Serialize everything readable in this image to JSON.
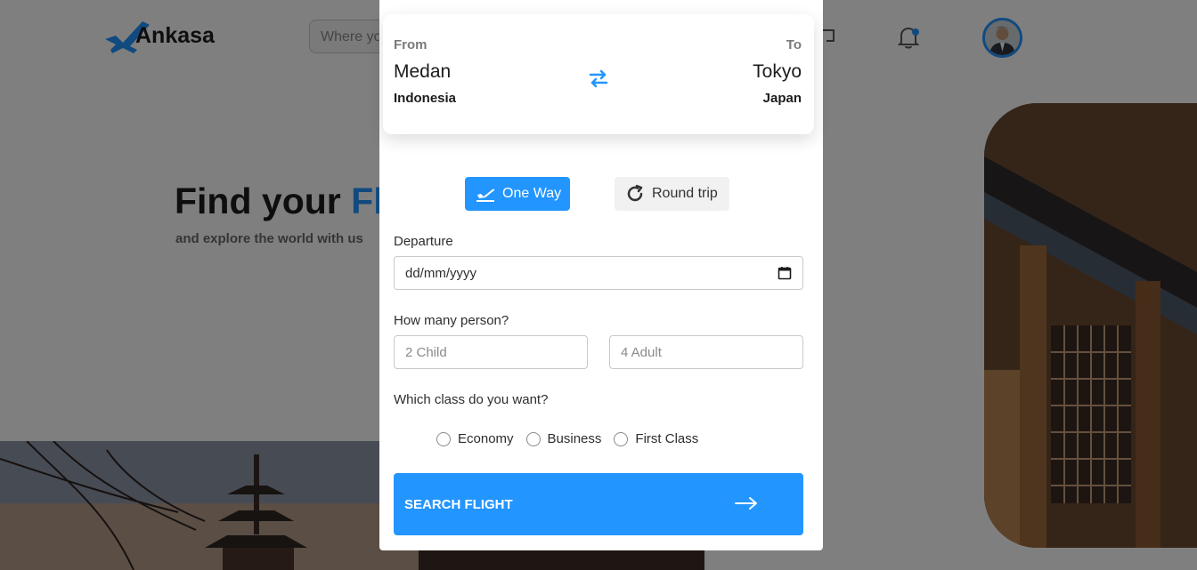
{
  "header": {
    "logo_text": "Ankasa",
    "search_placeholder": "Where you want to go?"
  },
  "hero": {
    "title_part1": "Find your ",
    "title_part2": "Flight",
    "subtitle": "and explore the world with us"
  },
  "modal": {
    "route": {
      "from_label": "From",
      "to_label": "To",
      "from_city": "Medan",
      "to_city": "Tokyo",
      "from_country": "Indonesia",
      "to_country": "Japan"
    },
    "trip_types": {
      "one_way": "One Way",
      "round_trip": "Round trip",
      "selected": "One Way"
    },
    "departure": {
      "label": "Departure",
      "placeholder": "dd/mm/yyyy"
    },
    "persons": {
      "label": "How many person?",
      "child_placeholder": "2 Child",
      "adult_placeholder": "4 Adult"
    },
    "class": {
      "label": "Which class do you want?",
      "options": [
        "Economy",
        "Business",
        "First Class"
      ]
    },
    "search_button": "SEARCH FLIGHT"
  },
  "colors": {
    "accent": "#2395ff",
    "overlay": "rgba(0,0,0,0.5)"
  }
}
